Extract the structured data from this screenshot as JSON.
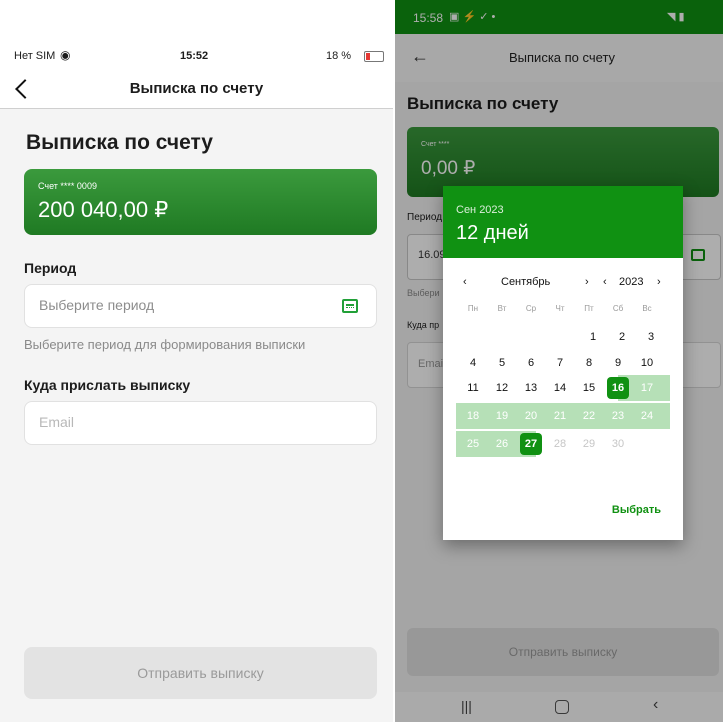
{
  "left": {
    "status": {
      "carrier": "Нет SIM",
      "time": "15:52",
      "battery": "18 %"
    },
    "nav_title": "Выписка по счету",
    "page_title": "Выписка по счету",
    "account": {
      "label": "Счет **** 0009",
      "balance": "200 040,00 ₽"
    },
    "period_label": "Период",
    "period_placeholder": "Выберите период",
    "period_hint": "Выберите период для формирования выписки",
    "send_label": "Куда прислать выписку",
    "email_placeholder": "Email",
    "submit": "Отправить выписку"
  },
  "right": {
    "status": {
      "time": "15:58"
    },
    "nav_title": "Выписка по счету",
    "page_title": "Выписка по счету",
    "account": {
      "label": "Счет ****",
      "balance": "0,00 ₽"
    },
    "period_label_partial": "Период",
    "period_value_partial": "16.09",
    "hint_partial": "Выбери",
    "send_partial": "Куда пр",
    "email_partial": "Emai",
    "submit": "Отправить выписку",
    "calendar": {
      "header_small": "Сен 2023",
      "header_large": "12 дней",
      "month": "Сентябрь",
      "year": "2023",
      "weekdays": [
        "Пн",
        "Вт",
        "Ср",
        "Чт",
        "Пт",
        "Сб",
        "Вс"
      ],
      "row1": [
        "1",
        "2",
        "3"
      ],
      "row2": [
        "4",
        "5",
        "6",
        "7",
        "8",
        "9",
        "10"
      ],
      "row3": [
        "11",
        "12",
        "13",
        "14",
        "15",
        "16",
        "17"
      ],
      "row4": [
        "18",
        "19",
        "20",
        "21",
        "22",
        "23",
        "24"
      ],
      "row5": [
        "25",
        "26",
        "27",
        "28",
        "29",
        "30"
      ],
      "action": "Выбрать"
    }
  },
  "colors": {
    "brand_green": "#109112",
    "range_light": "#b6e0b7",
    "card_green": "#1f7a23"
  }
}
